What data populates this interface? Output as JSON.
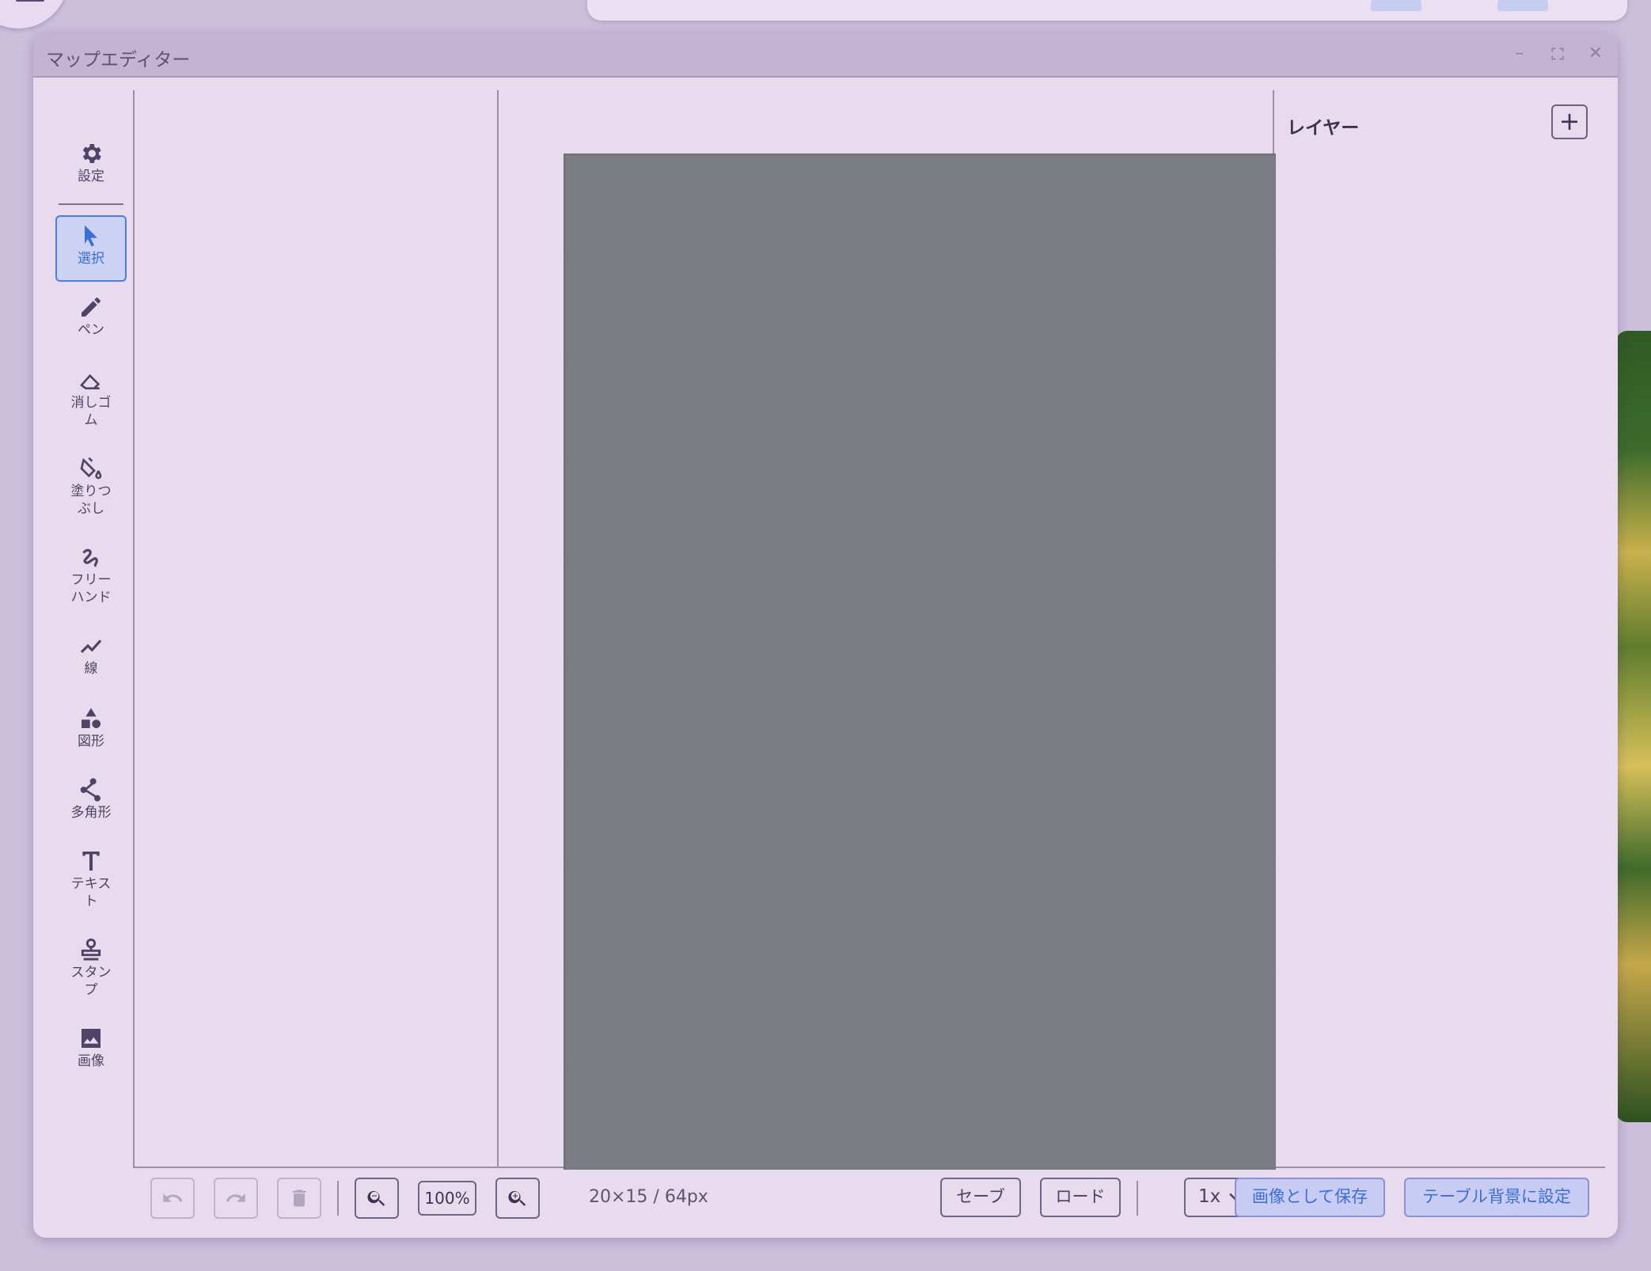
{
  "window": {
    "title": "マップエディター",
    "minimize_icon": "minimize-icon",
    "maximize_icon": "maximize-icon",
    "close_icon": "close-icon"
  },
  "toolbar": {
    "settings": {
      "label": "設定",
      "icon": "gear-icon"
    },
    "tools": [
      {
        "label": "選択",
        "icon": "cursor-icon",
        "active": true
      },
      {
        "label": "ペン",
        "icon": "pen-icon"
      },
      {
        "label": "消しゴム",
        "icon": "eraser-icon"
      },
      {
        "label": "塗りつぶし",
        "icon": "paint-bucket-icon"
      },
      {
        "label": "フリーハンド",
        "icon": "freehand-icon"
      },
      {
        "label": "線",
        "icon": "line-icon"
      },
      {
        "label": "図形",
        "icon": "shapes-icon"
      },
      {
        "label": "多角形",
        "icon": "polygon-icon"
      },
      {
        "label": "テキスト",
        "icon": "text-icon"
      },
      {
        "label": "スタンプ",
        "icon": "stamp-icon"
      },
      {
        "label": "画像",
        "icon": "image-icon"
      }
    ]
  },
  "layers": {
    "title": "レイヤー",
    "add_label": "+"
  },
  "bottombar": {
    "zoom": "100%",
    "map_size": "20×15 / 64px",
    "save": "セーブ",
    "load": "ロード",
    "scale": "1x",
    "save_image": "画像として保存",
    "set_background": "テーブル背景に設定"
  },
  "colors": {
    "accent": "#3a6fd8",
    "window_bg": "#e9dbee",
    "titlebar_bg": "#c4b3d5"
  }
}
